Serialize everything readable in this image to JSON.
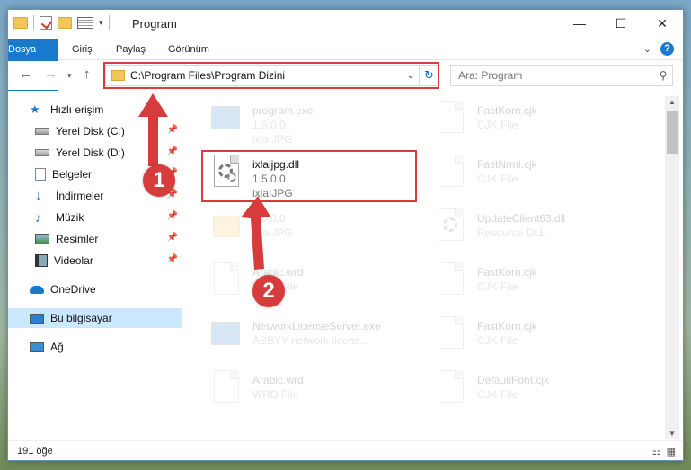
{
  "window": {
    "title": "Program"
  },
  "ribbon": {
    "file_tab": "Dosya",
    "tabs": [
      "Giriş",
      "Paylaş",
      "Görünüm"
    ]
  },
  "address": {
    "path": "C:\\Program Files\\Program Dizini"
  },
  "search": {
    "placeholder": "Ara: Program"
  },
  "sidebar": {
    "items": [
      {
        "label": "Hızlı erişim"
      },
      {
        "label": "Yerel Disk (C:)"
      },
      {
        "label": "Yerel Disk (D:)"
      },
      {
        "label": "Belgeler"
      },
      {
        "label": "İndirmeler"
      },
      {
        "label": "Müzik"
      },
      {
        "label": "Resimler"
      },
      {
        "label": "Videolar"
      },
      {
        "label": "OneDrive"
      },
      {
        "label": "Bu bilgisayar"
      },
      {
        "label": "Ağ"
      }
    ]
  },
  "files": [
    {
      "name": "program.exe",
      "line2": "1.5.0.0",
      "line3": "ixlaIJPG"
    },
    {
      "name": "ixlaijpg.dll",
      "line2": "1.5.0.0",
      "line3": "ixlaIJPG"
    },
    {
      "name": "",
      "line2": "1.5.0.0",
      "line3": "ixlaIJPG"
    },
    {
      "name": "Arabic.wrd",
      "line2": "WRD File",
      "line3": ""
    },
    {
      "name": "NetworkLicenseServer.exe",
      "line2": "ABBYY network licens...",
      "line3": ""
    },
    {
      "name": "Arabic.wrd",
      "line2": "WRD File",
      "line3": ""
    },
    {
      "name": "FastKorn.cjk",
      "line2": "CJK File",
      "line3": ""
    },
    {
      "name": "FastNrml.cjk",
      "line2": "CJK File",
      "line3": ""
    },
    {
      "name": "UpdateClient63.dll",
      "line2": "Resource DLL",
      "line3": ""
    },
    {
      "name": "FastKorn.cjk",
      "line2": "CJK File",
      "line3": ""
    },
    {
      "name": "FastKorn.cjk",
      "line2": "CJK File",
      "line3": ""
    },
    {
      "name": "DefaultFont.cjk",
      "line2": "CJK File",
      "line3": ""
    }
  ],
  "status": {
    "count": "191 öğe"
  },
  "markers": [
    "1",
    "2"
  ],
  "colors": {
    "accent": "#1979ca",
    "highlight": "#d83b3b",
    "selected": "#cce8ff"
  }
}
